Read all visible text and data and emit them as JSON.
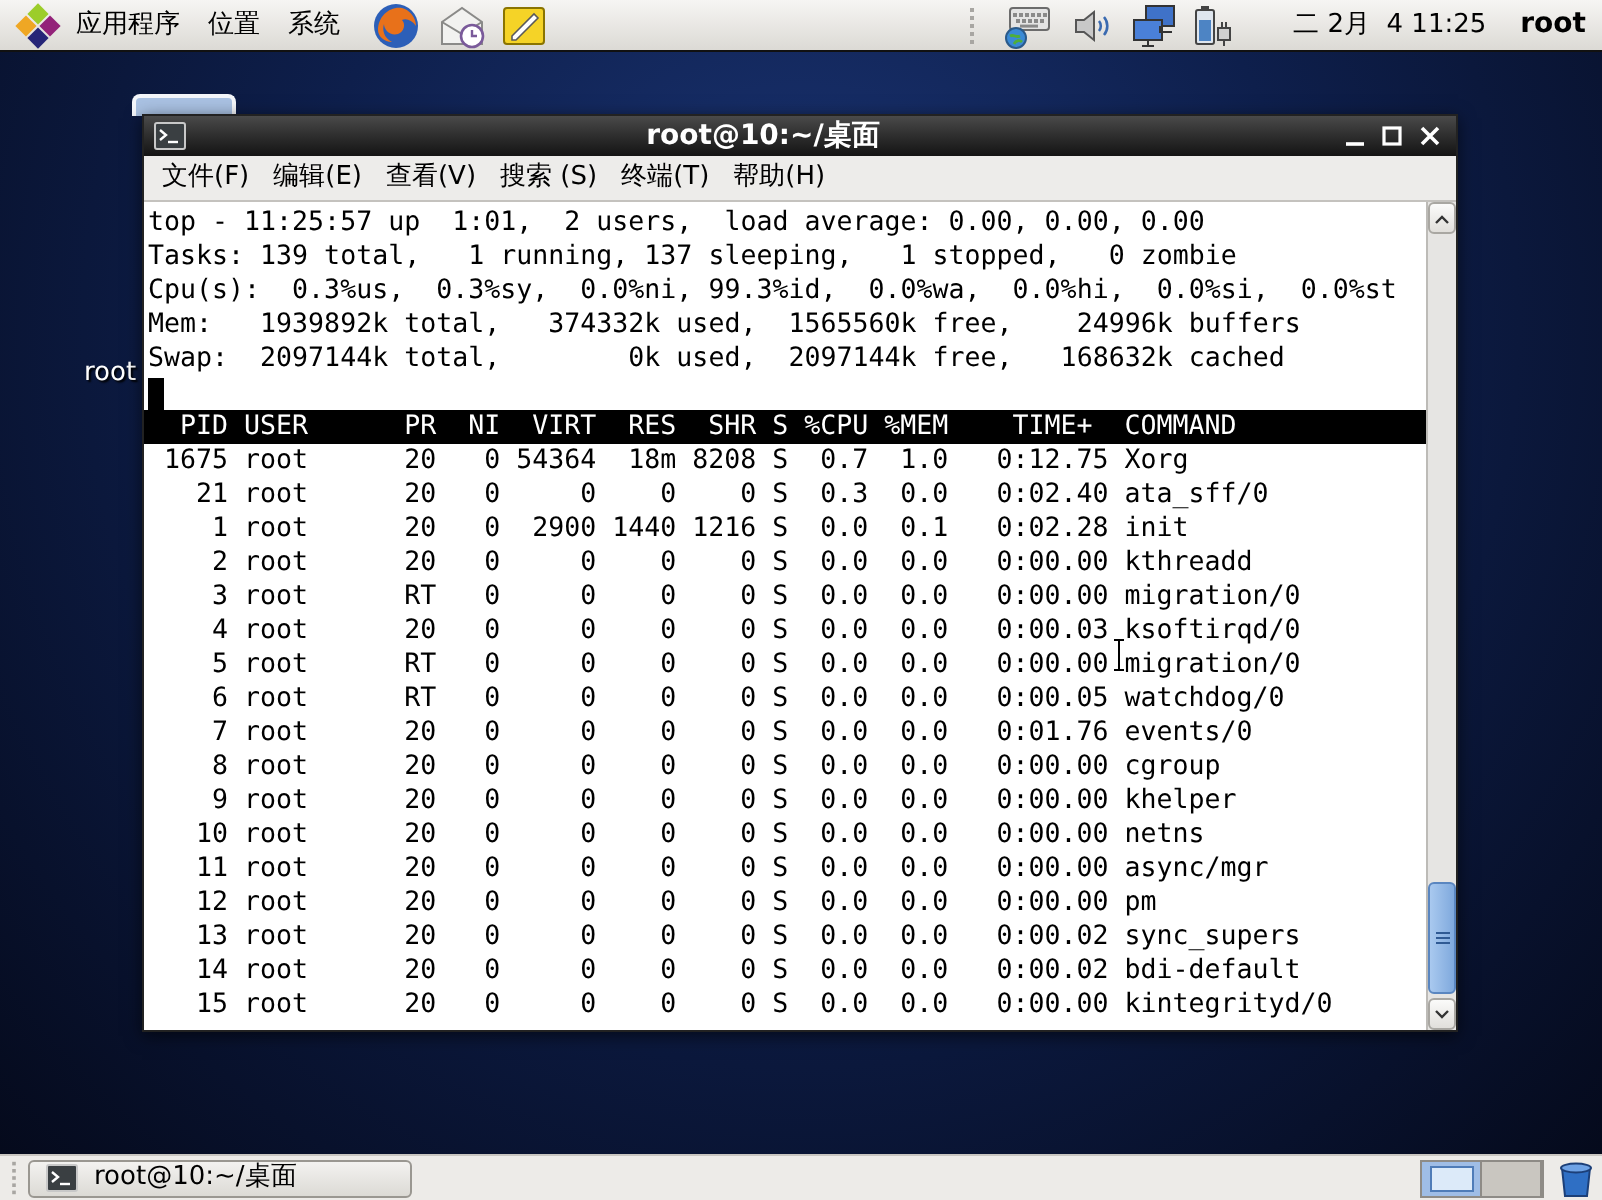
{
  "top_panel": {
    "menus": [
      "应用程序",
      "位置",
      "系统"
    ],
    "clock": "二 2月  4 11:25",
    "user": "root"
  },
  "desktop": {
    "icons": [
      {
        "label": "root"
      }
    ]
  },
  "terminal": {
    "title": "root@10:~/桌面",
    "menu": [
      "文件(F)",
      "编辑(E)",
      "查看(V)",
      "搜索 (S)",
      "终端(T)",
      "帮助(H)"
    ],
    "summary": [
      "top - 11:25:57 up  1:01,  2 users,  load average: 0.00, 0.00, 0.00",
      "Tasks: 139 total,   1 running, 137 sleeping,   1 stopped,   0 zombie",
      "Cpu(s):  0.3%us,  0.3%sy,  0.0%ni, 99.3%id,  0.0%wa,  0.0%hi,  0.0%si,  0.0%st",
      "Mem:   1939892k total,   374332k used,  1565560k free,    24996k buffers",
      "Swap:  2097144k total,        0k used,  2097144k free,   168632k cached"
    ],
    "table": {
      "columns": [
        "PID",
        "USER",
        "PR",
        "NI",
        "VIRT",
        "RES",
        "SHR",
        "S",
        "%CPU",
        "%MEM",
        "TIME+",
        "COMMAND"
      ],
      "rows": [
        [
          "1675",
          "root",
          "20",
          "0",
          "54364",
          "18m",
          "8208",
          "S",
          "0.7",
          "1.0",
          "0:12.75",
          "Xorg"
        ],
        [
          "21",
          "root",
          "20",
          "0",
          "0",
          "0",
          "0",
          "S",
          "0.3",
          "0.0",
          "0:02.40",
          "ata_sff/0"
        ],
        [
          "1",
          "root",
          "20",
          "0",
          "2900",
          "1440",
          "1216",
          "S",
          "0.0",
          "0.1",
          "0:02.28",
          "init"
        ],
        [
          "2",
          "root",
          "20",
          "0",
          "0",
          "0",
          "0",
          "S",
          "0.0",
          "0.0",
          "0:00.00",
          "kthreadd"
        ],
        [
          "3",
          "root",
          "RT",
          "0",
          "0",
          "0",
          "0",
          "S",
          "0.0",
          "0.0",
          "0:00.00",
          "migration/0"
        ],
        [
          "4",
          "root",
          "20",
          "0",
          "0",
          "0",
          "0",
          "S",
          "0.0",
          "0.0",
          "0:00.03",
          "ksoftirqd/0"
        ],
        [
          "5",
          "root",
          "RT",
          "0",
          "0",
          "0",
          "0",
          "S",
          "0.0",
          "0.0",
          "0:00.00",
          "migration/0"
        ],
        [
          "6",
          "root",
          "RT",
          "0",
          "0",
          "0",
          "0",
          "S",
          "0.0",
          "0.0",
          "0:00.05",
          "watchdog/0"
        ],
        [
          "7",
          "root",
          "20",
          "0",
          "0",
          "0",
          "0",
          "S",
          "0.0",
          "0.0",
          "0:01.76",
          "events/0"
        ],
        [
          "8",
          "root",
          "20",
          "0",
          "0",
          "0",
          "0",
          "S",
          "0.0",
          "0.0",
          "0:00.00",
          "cgroup"
        ],
        [
          "9",
          "root",
          "20",
          "0",
          "0",
          "0",
          "0",
          "S",
          "0.0",
          "0.0",
          "0:00.00",
          "khelper"
        ],
        [
          "10",
          "root",
          "20",
          "0",
          "0",
          "0",
          "0",
          "S",
          "0.0",
          "0.0",
          "0:00.00",
          "netns"
        ],
        [
          "11",
          "root",
          "20",
          "0",
          "0",
          "0",
          "0",
          "S",
          "0.0",
          "0.0",
          "0:00.00",
          "async/mgr"
        ],
        [
          "12",
          "root",
          "20",
          "0",
          "0",
          "0",
          "0",
          "S",
          "0.0",
          "0.0",
          "0:00.00",
          "pm"
        ],
        [
          "13",
          "root",
          "20",
          "0",
          "0",
          "0",
          "0",
          "S",
          "0.0",
          "0.0",
          "0:00.02",
          "sync_supers"
        ],
        [
          "14",
          "root",
          "20",
          "0",
          "0",
          "0",
          "0",
          "S",
          "0.0",
          "0.0",
          "0:00.02",
          "bdi-default"
        ],
        [
          "15",
          "root",
          "20",
          "0",
          "0",
          "0",
          "0",
          "S",
          "0.0",
          "0.0",
          "0:00.00",
          "kintegrityd/0"
        ]
      ]
    }
  },
  "taskbar": {
    "tasks": [
      {
        "label": "root@10:~/桌面",
        "selected": false
      }
    ],
    "workspaces": [
      {
        "selected": true
      },
      {
        "selected": false
      }
    ]
  }
}
